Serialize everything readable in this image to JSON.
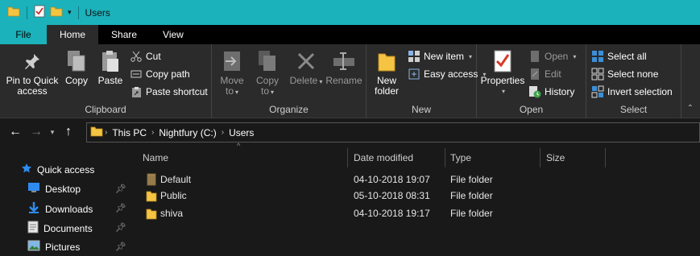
{
  "window": {
    "title": "Users"
  },
  "tabs": [
    {
      "label": "File"
    },
    {
      "label": "Home"
    },
    {
      "label": "Share"
    },
    {
      "label": "View"
    }
  ],
  "ribbon": {
    "clipboard": {
      "label": "Clipboard",
      "pin_quick_access": [
        "Pin to Quick",
        "access"
      ],
      "copy": "Copy",
      "paste": "Paste",
      "cut": "Cut",
      "copy_path": "Copy path",
      "paste_shortcut": "Paste shortcut"
    },
    "organize": {
      "label": "Organize",
      "move_to": [
        "Move",
        "to"
      ],
      "copy_to": [
        "Copy",
        "to"
      ],
      "delete": "Delete",
      "rename": "Rename"
    },
    "new": {
      "label": "New",
      "new_folder": [
        "New",
        "folder"
      ],
      "new_item": "New item",
      "easy_access": "Easy access"
    },
    "open": {
      "label": "Open",
      "properties": "Properties",
      "open": "Open",
      "edit": "Edit",
      "history": "History"
    },
    "select": {
      "label": "Select",
      "select_all": "Select all",
      "select_none": "Select none",
      "invert_selection": "Invert selection"
    }
  },
  "address": {
    "crumbs": [
      "This PC",
      "Nightfury (C:)",
      "Users"
    ]
  },
  "navpane": {
    "items": [
      {
        "label": "Quick access",
        "icon": "star-icon"
      },
      {
        "label": "Desktop",
        "icon": "desktop-icon"
      },
      {
        "label": "Downloads",
        "icon": "downloads-icon"
      },
      {
        "label": "Documents",
        "icon": "documents-icon"
      },
      {
        "label": "Pictures",
        "icon": "pictures-icon"
      }
    ]
  },
  "filelist": {
    "columns": [
      "Name",
      "Date modified",
      "Type",
      "Size"
    ],
    "rows": [
      {
        "name": "Default",
        "date": "04-10-2018 19:07",
        "type": "File folder",
        "size": ""
      },
      {
        "name": "Public",
        "date": "05-10-2018 08:31",
        "type": "File folder",
        "size": ""
      },
      {
        "name": "shiva",
        "date": "04-10-2018 19:17",
        "type": "File folder",
        "size": ""
      }
    ]
  },
  "colors": {
    "accent": "#1bb2bb",
    "folder": "#f6c443",
    "background": "#191919",
    "ribbon": "#2b2b2b"
  }
}
